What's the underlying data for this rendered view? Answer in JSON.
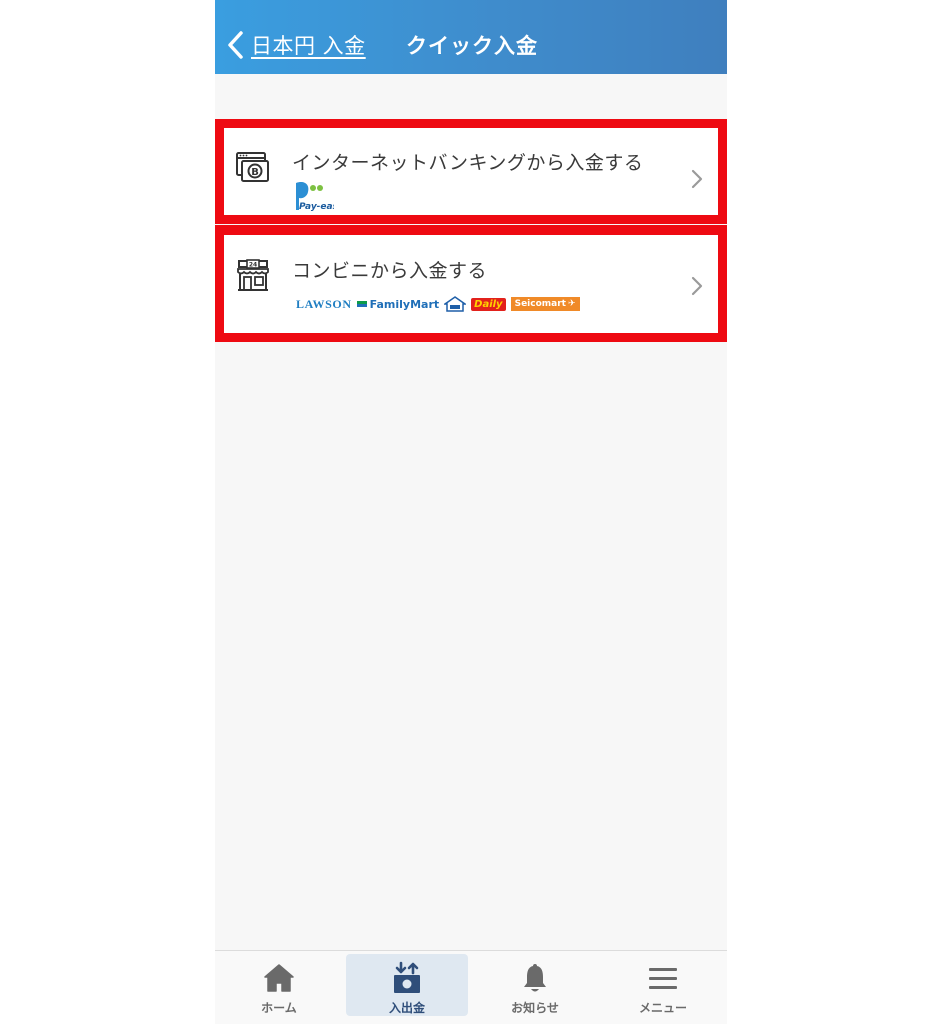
{
  "header": {
    "back_label": "日本円 入金",
    "title": "クイック入金"
  },
  "options": [
    {
      "label": "インターネットバンキングから入金する",
      "logo": "Pay-easy"
    },
    {
      "label": "コンビニから入金する",
      "logos": {
        "lawson": "LAWSON",
        "familymart": "FamilyMart",
        "daily": "Daily",
        "seicomart": "Seicomart"
      },
      "icon_text": "24"
    }
  ],
  "tabbar": {
    "items": [
      {
        "label": "ホーム",
        "icon": "home-icon"
      },
      {
        "label": "入出金",
        "icon": "deposit-withdraw-icon",
        "active": true
      },
      {
        "label": "お知らせ",
        "icon": "bell-icon"
      },
      {
        "label": "メニュー",
        "icon": "menu-icon"
      }
    ]
  },
  "colors": {
    "header_start": "#3a9ee0",
    "header_end": "#3f7fbe",
    "highlight_border": "#ee0a12",
    "active_tab_bg": "#dfe8f1"
  }
}
